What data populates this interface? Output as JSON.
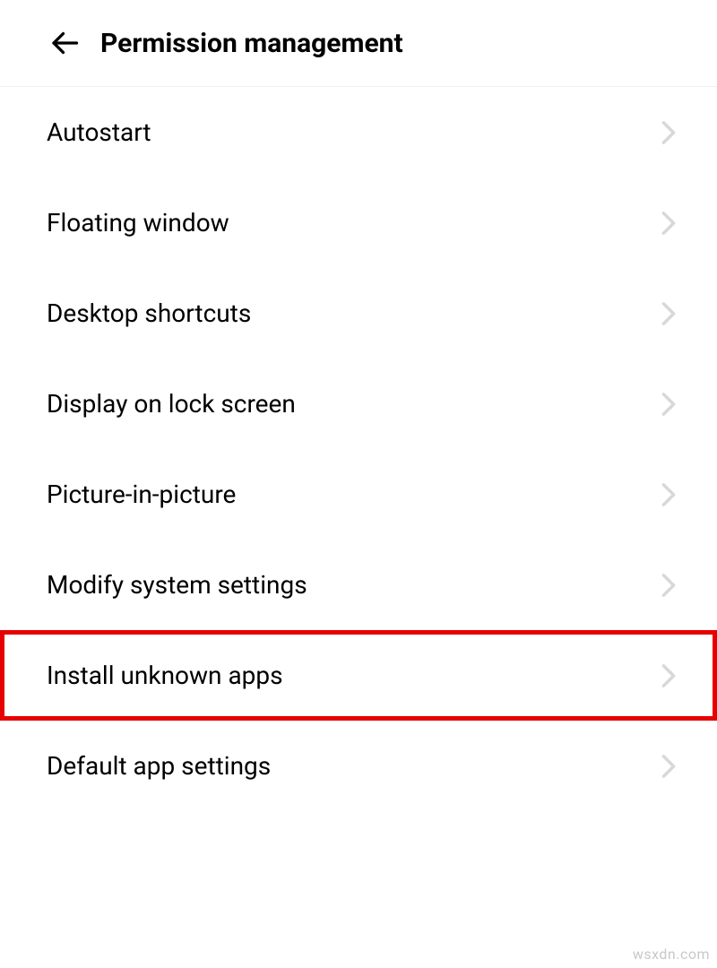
{
  "header": {
    "title": "Permission management"
  },
  "settings": {
    "items": [
      {
        "label": "Autostart",
        "highlighted": false
      },
      {
        "label": "Floating window",
        "highlighted": false
      },
      {
        "label": "Desktop shortcuts",
        "highlighted": false
      },
      {
        "label": "Display on lock screen",
        "highlighted": false
      },
      {
        "label": "Picture-in-picture",
        "highlighted": false
      },
      {
        "label": "Modify system settings",
        "highlighted": false
      },
      {
        "label": "Install unknown apps",
        "highlighted": true
      },
      {
        "label": "Default app settings",
        "highlighted": false
      }
    ]
  },
  "watermark": "wsxdn.com",
  "colors": {
    "highlight_border": "#e60000",
    "chevron": "#d8d8d8",
    "text": "#000000"
  }
}
